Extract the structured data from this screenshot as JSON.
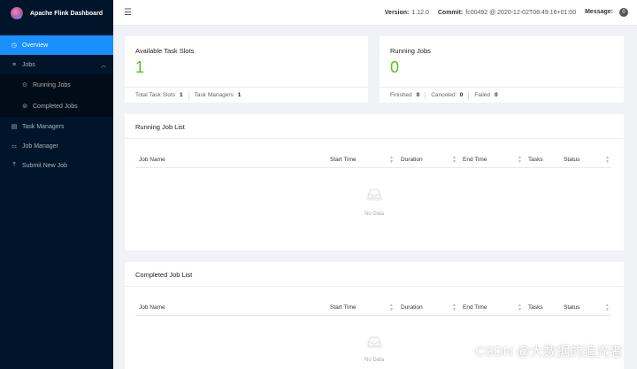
{
  "app": {
    "title": "Apache Flink Dashboard"
  },
  "sidebar": {
    "items": [
      {
        "label": "Overview",
        "icon": "dashboard-icon"
      },
      {
        "label": "Jobs",
        "icon": "list-icon"
      },
      {
        "label": "Running Jobs",
        "icon": "play-circle-icon"
      },
      {
        "label": "Completed Jobs",
        "icon": "check-circle-icon"
      },
      {
        "label": "Task Managers",
        "icon": "schedule-icon"
      },
      {
        "label": "Job Manager",
        "icon": "cluster-icon"
      },
      {
        "label": "Submit New Job",
        "icon": "upload-icon"
      }
    ]
  },
  "header": {
    "version_label": "Version:",
    "version": "1.12.0",
    "commit_label": "Commit:",
    "commit": "fc00492 @ 2020-12-02T08:49:16+01:00",
    "message_label": "Message:",
    "message_count": "0"
  },
  "slots": {
    "title": "Available Task Slots",
    "value": "1",
    "total_label": "Total Task Slots",
    "total": "1",
    "tm_label": "Task Managers",
    "tm": "1"
  },
  "running": {
    "title": "Running Jobs",
    "value": "0",
    "finished_label": "Finished",
    "finished": "0",
    "canceled_label": "Canceled",
    "canceled": "0",
    "failed_label": "Failed",
    "failed": "0"
  },
  "running_list": {
    "title": "Running Job List",
    "nodata": "No Data"
  },
  "completed_list": {
    "title": "Completed Job List",
    "nodata": "No Data"
  },
  "columns": {
    "name": "Job Name",
    "start": "Start Time",
    "duration": "Duration",
    "end": "End Time",
    "tasks": "Tasks",
    "status": "Status"
  },
  "watermark": "CSDN @大数据的追光者",
  "colors": {
    "sidebar": "#001529",
    "active": "#1890ff",
    "green": "#52c41a"
  }
}
